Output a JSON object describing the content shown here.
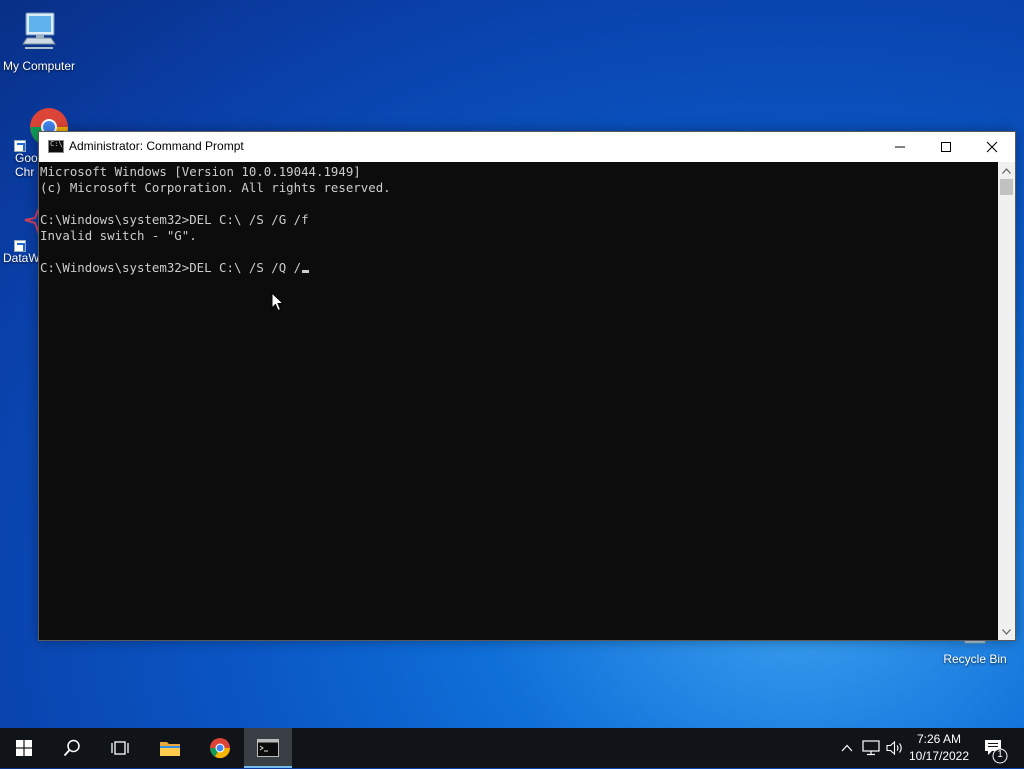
{
  "desktop": {
    "icons": [
      {
        "label": "My Computer"
      },
      {
        "label": "Goo\nChr"
      },
      {
        "label": "DataW"
      },
      {
        "label": "Recycle Bin"
      }
    ]
  },
  "window": {
    "title": "Administrator: Command Prompt",
    "console_lines": [
      "Microsoft Windows [Version 10.0.19044.1949]",
      "(c) Microsoft Corporation. All rights reserved.",
      "",
      "C:\\Windows\\system32>DEL C:\\ /S /G /f",
      "Invalid switch - \"G\".",
      "",
      "C:\\Windows\\system32>DEL C:\\ /S /Q /"
    ]
  },
  "taskbar": {
    "clock_time": "7:26 AM",
    "clock_date": "10/17/2022",
    "notification_count": "1"
  },
  "colors": {
    "console_bg": "#0c0c0c",
    "console_fg": "#cccccc",
    "taskbar_bg": "#101418",
    "accent": "#76b9ed"
  }
}
